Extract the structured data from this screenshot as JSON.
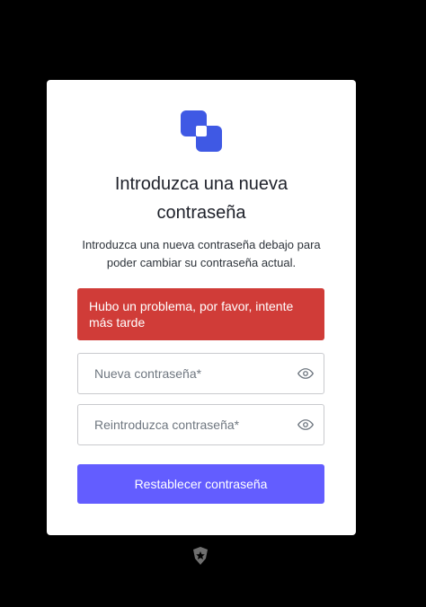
{
  "header": {
    "title": "Introduzca una nueva contraseña",
    "subtitle": "Introduzca una nueva contraseña debajo para poder cambiar su contraseña actual."
  },
  "error": {
    "message": "Hubo un problema, por favor, intente más tarde"
  },
  "form": {
    "new_password": {
      "placeholder": "Nueva contraseña*",
      "value": ""
    },
    "confirm_password": {
      "placeholder": "Reintroduzca contraseña*",
      "value": ""
    },
    "submit_label": "Restablecer contraseña"
  },
  "icons": {
    "logo": "app-logo-icon",
    "show_password": "eye-icon",
    "footer": "auth0-shield-icon"
  },
  "colors": {
    "accent": "#635dff",
    "error": "#d03c38",
    "logo": "#3f59e4"
  }
}
